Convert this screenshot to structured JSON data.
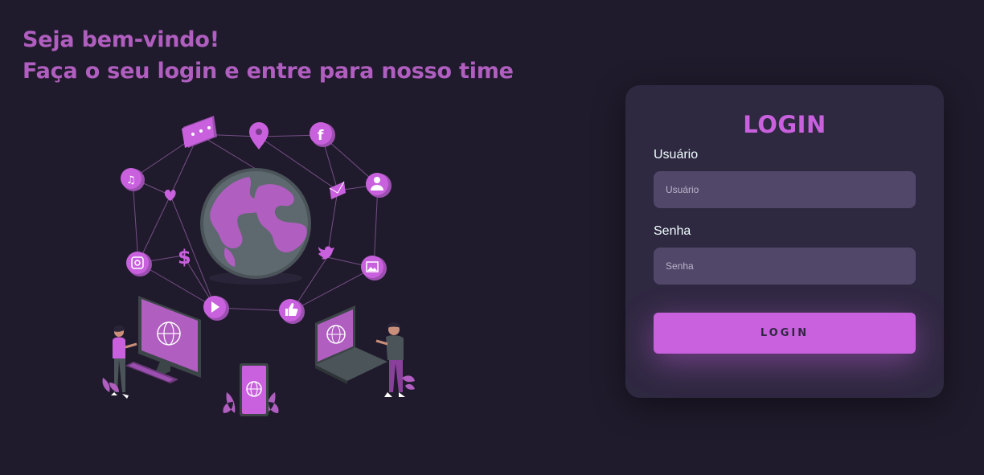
{
  "welcome": {
    "line1": "Seja bem-vindo!",
    "line2": "Faça o seu login e entre para nosso time"
  },
  "login": {
    "title": "LOGIN",
    "username_label": "Usuário",
    "username_placeholder": "Usuário",
    "password_label": "Senha",
    "password_placeholder": "Senha",
    "button_label": "LOGIN"
  },
  "colors": {
    "background": "#201b2c",
    "card": "#2f2841",
    "accent": "#c961de",
    "input": "#514869",
    "heading": "#b05ec0"
  },
  "illustration": {
    "icons": [
      "chat-icon",
      "location-pin-icon",
      "facebook-icon",
      "music-icon",
      "heart-icon",
      "mail-icon",
      "user-icon",
      "dollar-icon",
      "twitter-icon",
      "instagram-icon",
      "image-icon",
      "play-icon",
      "like-icon",
      "globe-icon",
      "desktop-icon",
      "smartphone-icon",
      "laptop-icon"
    ]
  }
}
